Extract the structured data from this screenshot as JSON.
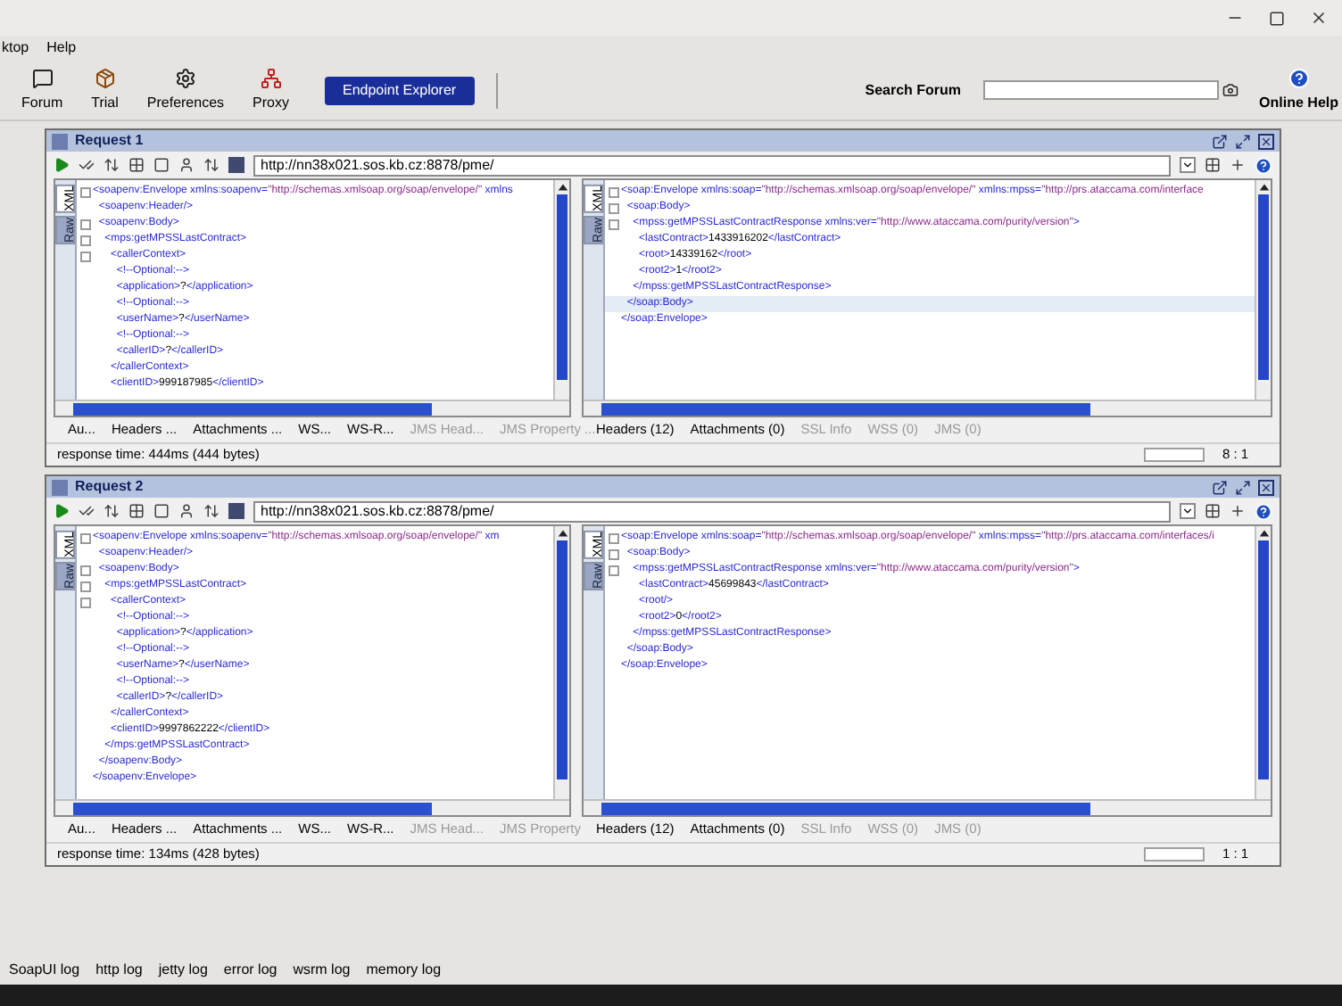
{
  "menu": [
    "ktop",
    "Help"
  ],
  "toolbar": {
    "buttons": [
      {
        "kind": "forum",
        "label": "Forum"
      },
      {
        "kind": "trial",
        "label": "Trial"
      },
      {
        "kind": "preferences",
        "label": "Preferences"
      },
      {
        "kind": "proxy",
        "label": "Proxy"
      }
    ],
    "endpoint_button": "Endpoint Explorer",
    "search": {
      "label": "Search Forum"
    },
    "help": "Online Help"
  },
  "requests": [
    {
      "title": "Request 1",
      "url": "http://nn38x021.sos.kb.cz:8878/pme/",
      "request": {
        "view_tabs": [
          {
            "label": "XML",
            "selected": true
          },
          {
            "label": "Raw",
            "selected": false
          }
        ],
        "lines": [
          {
            "text": "<soapenv:Envelope xmlns:soapenv=\"http://schemas.xmlsoap.org/soap/envelope/\" xmlns",
            "fold": true,
            "selected": false
          },
          {
            "text": "  <soapenv:Header/>",
            "fold": false,
            "selected": false
          },
          {
            "text": "  <soapenv:Body>",
            "fold": true,
            "selected": false
          },
          {
            "text": "    <mps:getMPSSLastContract>",
            "fold": true,
            "selected": false
          },
          {
            "text": "      <callerContext>",
            "fold": true,
            "selected": false
          },
          {
            "text": "        <!--Optional:-->",
            "fold": false,
            "selected": false
          },
          {
            "text": "        <application>?</application>",
            "fold": false,
            "selected": false
          },
          {
            "text": "        <!--Optional:-->",
            "fold": false,
            "selected": false
          },
          {
            "text": "        <userName>?</userName>",
            "fold": false,
            "selected": false
          },
          {
            "text": "        <!--Optional:-->",
            "fold": false,
            "selected": false
          },
          {
            "text": "        <callerID>?</callerID>",
            "fold": false,
            "selected": false
          },
          {
            "text": "      </callerContext>",
            "fold": false,
            "selected": false
          },
          {
            "text": "      <clientID>999187985</clientID>",
            "fold": false,
            "selected": false
          }
        ],
        "tabs": [
          {
            "label": "Au...",
            "disabled": false
          },
          {
            "label": "Headers ...",
            "disabled": false
          },
          {
            "label": "Attachments ...",
            "disabled": false
          },
          {
            "label": "WS...",
            "disabled": false
          },
          {
            "label": "WS-R...",
            "disabled": false
          },
          {
            "label": "JMS Head...",
            "disabled": true
          },
          {
            "label": "JMS Property ...",
            "disabled": true
          }
        ]
      },
      "response": {
        "view_tabs": [
          {
            "label": "XML",
            "selected": true
          },
          {
            "label": "Raw",
            "selected": false
          }
        ],
        "lines": [
          {
            "text": "<soap:Envelope xmlns:soap=\"http://schemas.xmlsoap.org/soap/envelope/\" xmlns:mpss=\"http://prs.ataccama.com/interface",
            "fold": true,
            "selected": false
          },
          {
            "text": "  <soap:Body>",
            "fold": true,
            "selected": false
          },
          {
            "text": "    <mpss:getMPSSLastContractResponse xmlns:ver=\"http://www.ataccama.com/purity/version\">",
            "fold": true,
            "selected": false
          },
          {
            "text": "      <lastContract>1433916202</lastContract>",
            "fold": false,
            "selected": false
          },
          {
            "text": "      <root>14339162</root>",
            "fold": false,
            "selected": false
          },
          {
            "text": "      <root2>1</root2>",
            "fold": false,
            "selected": false
          },
          {
            "text": "    </mpss:getMPSSLastContractResponse>",
            "fold": false,
            "selected": false
          },
          {
            "text": "  </soap:Body>",
            "fold": false,
            "selected": true
          },
          {
            "text": "</soap:Envelope>",
            "fold": false,
            "selected": false
          }
        ],
        "tabs": [
          {
            "label": "Headers (12)",
            "disabled": false
          },
          {
            "label": "Attachments (0)",
            "disabled": false
          },
          {
            "label": "SSL Info",
            "disabled": true
          },
          {
            "label": "WSS (0)",
            "disabled": true
          },
          {
            "label": "JMS (0)",
            "disabled": true
          }
        ]
      },
      "status": "response time: 444ms (444 bytes)",
      "progress": {
        "level": 0
      },
      "position": "8 : 1"
    },
    {
      "title": "Request 2",
      "url": "http://nn38x021.sos.kb.cz:8878/pme/",
      "request": {
        "view_tabs": [
          {
            "label": "XML",
            "selected": true
          },
          {
            "label": "Raw",
            "selected": false
          }
        ],
        "lines": [
          {
            "text": "<soapenv:Envelope xmlns:soapenv=\"http://schemas.xmlsoap.org/soap/envelope/\" xm",
            "fold": true,
            "selected": false
          },
          {
            "text": "  <soapenv:Header/>",
            "fold": false,
            "selected": false
          },
          {
            "text": "  <soapenv:Body>",
            "fold": true,
            "selected": false
          },
          {
            "text": "    <mps:getMPSSLastContract>",
            "fold": true,
            "selected": false
          },
          {
            "text": "      <callerContext>",
            "fold": true,
            "selected": false
          },
          {
            "text": "        <!--Optional:-->",
            "fold": false,
            "selected": false
          },
          {
            "text": "        <application>?</application>",
            "fold": false,
            "selected": false
          },
          {
            "text": "        <!--Optional:-->",
            "fold": false,
            "selected": false
          },
          {
            "text": "        <userName>?</userName>",
            "fold": false,
            "selected": false
          },
          {
            "text": "        <!--Optional:-->",
            "fold": false,
            "selected": false
          },
          {
            "text": "        <callerID>?</callerID>",
            "fold": false,
            "selected": false
          },
          {
            "text": "      </callerContext>",
            "fold": false,
            "selected": false
          },
          {
            "text": "      <clientID>9997862222</clientID>",
            "fold": false,
            "selected": false
          },
          {
            "text": "    </mps:getMPSSLastContract>",
            "fold": false,
            "selected": false
          },
          {
            "text": "  </soapenv:Body>",
            "fold": false,
            "selected": false
          },
          {
            "text": "</soapenv:Envelope>",
            "fold": false,
            "selected": false
          }
        ],
        "tabs": [
          {
            "label": "Au...",
            "disabled": false
          },
          {
            "label": "Headers ...",
            "disabled": false
          },
          {
            "label": "Attachments ...",
            "disabled": false
          },
          {
            "label": "WS...",
            "disabled": false
          },
          {
            "label": "WS-R...",
            "disabled": false
          },
          {
            "label": "JMS Head...",
            "disabled": true
          },
          {
            "label": "JMS Property",
            "disabled": true
          }
        ]
      },
      "response": {
        "view_tabs": [
          {
            "label": "XML",
            "selected": true
          },
          {
            "label": "Raw",
            "selected": false
          }
        ],
        "lines": [
          {
            "text": "<soap:Envelope xmlns:soap=\"http://schemas.xmlsoap.org/soap/envelope/\" xmlns:mpss=\"http://prs.ataccama.com/interfaces/i",
            "fold": true,
            "selected": false
          },
          {
            "text": "  <soap:Body>",
            "fold": true,
            "selected": false
          },
          {
            "text": "    <mpss:getMPSSLastContractResponse xmlns:ver=\"http://www.ataccama.com/purity/version\">",
            "fold": true,
            "selected": false
          },
          {
            "text": "      <lastContract>45699843</lastContract>",
            "fold": false,
            "selected": false
          },
          {
            "text": "      <root/>",
            "fold": false,
            "selected": false
          },
          {
            "text": "      <root2>0</root2>",
            "fold": false,
            "selected": false
          },
          {
            "text": "    </mpss:getMPSSLastContractResponse>",
            "fold": false,
            "selected": false
          },
          {
            "text": "  </soap:Body>",
            "fold": false,
            "selected": false
          },
          {
            "text": "</soap:Envelope>",
            "fold": false,
            "selected": false
          }
        ],
        "tabs": [
          {
            "label": "Headers (12)",
            "disabled": false
          },
          {
            "label": "Attachments (0)",
            "disabled": false
          },
          {
            "label": "SSL Info",
            "disabled": true
          },
          {
            "label": "WSS (0)",
            "disabled": true
          },
          {
            "label": "JMS (0)",
            "disabled": true
          }
        ]
      },
      "status": "response time: 134ms (428 bytes)",
      "progress": {
        "level": 0
      },
      "position": "1 : 1"
    }
  ],
  "log_tabs": [
    "SoapUI log",
    "http log",
    "jetty log",
    "error log",
    "wsrm log",
    "memory log"
  ]
}
